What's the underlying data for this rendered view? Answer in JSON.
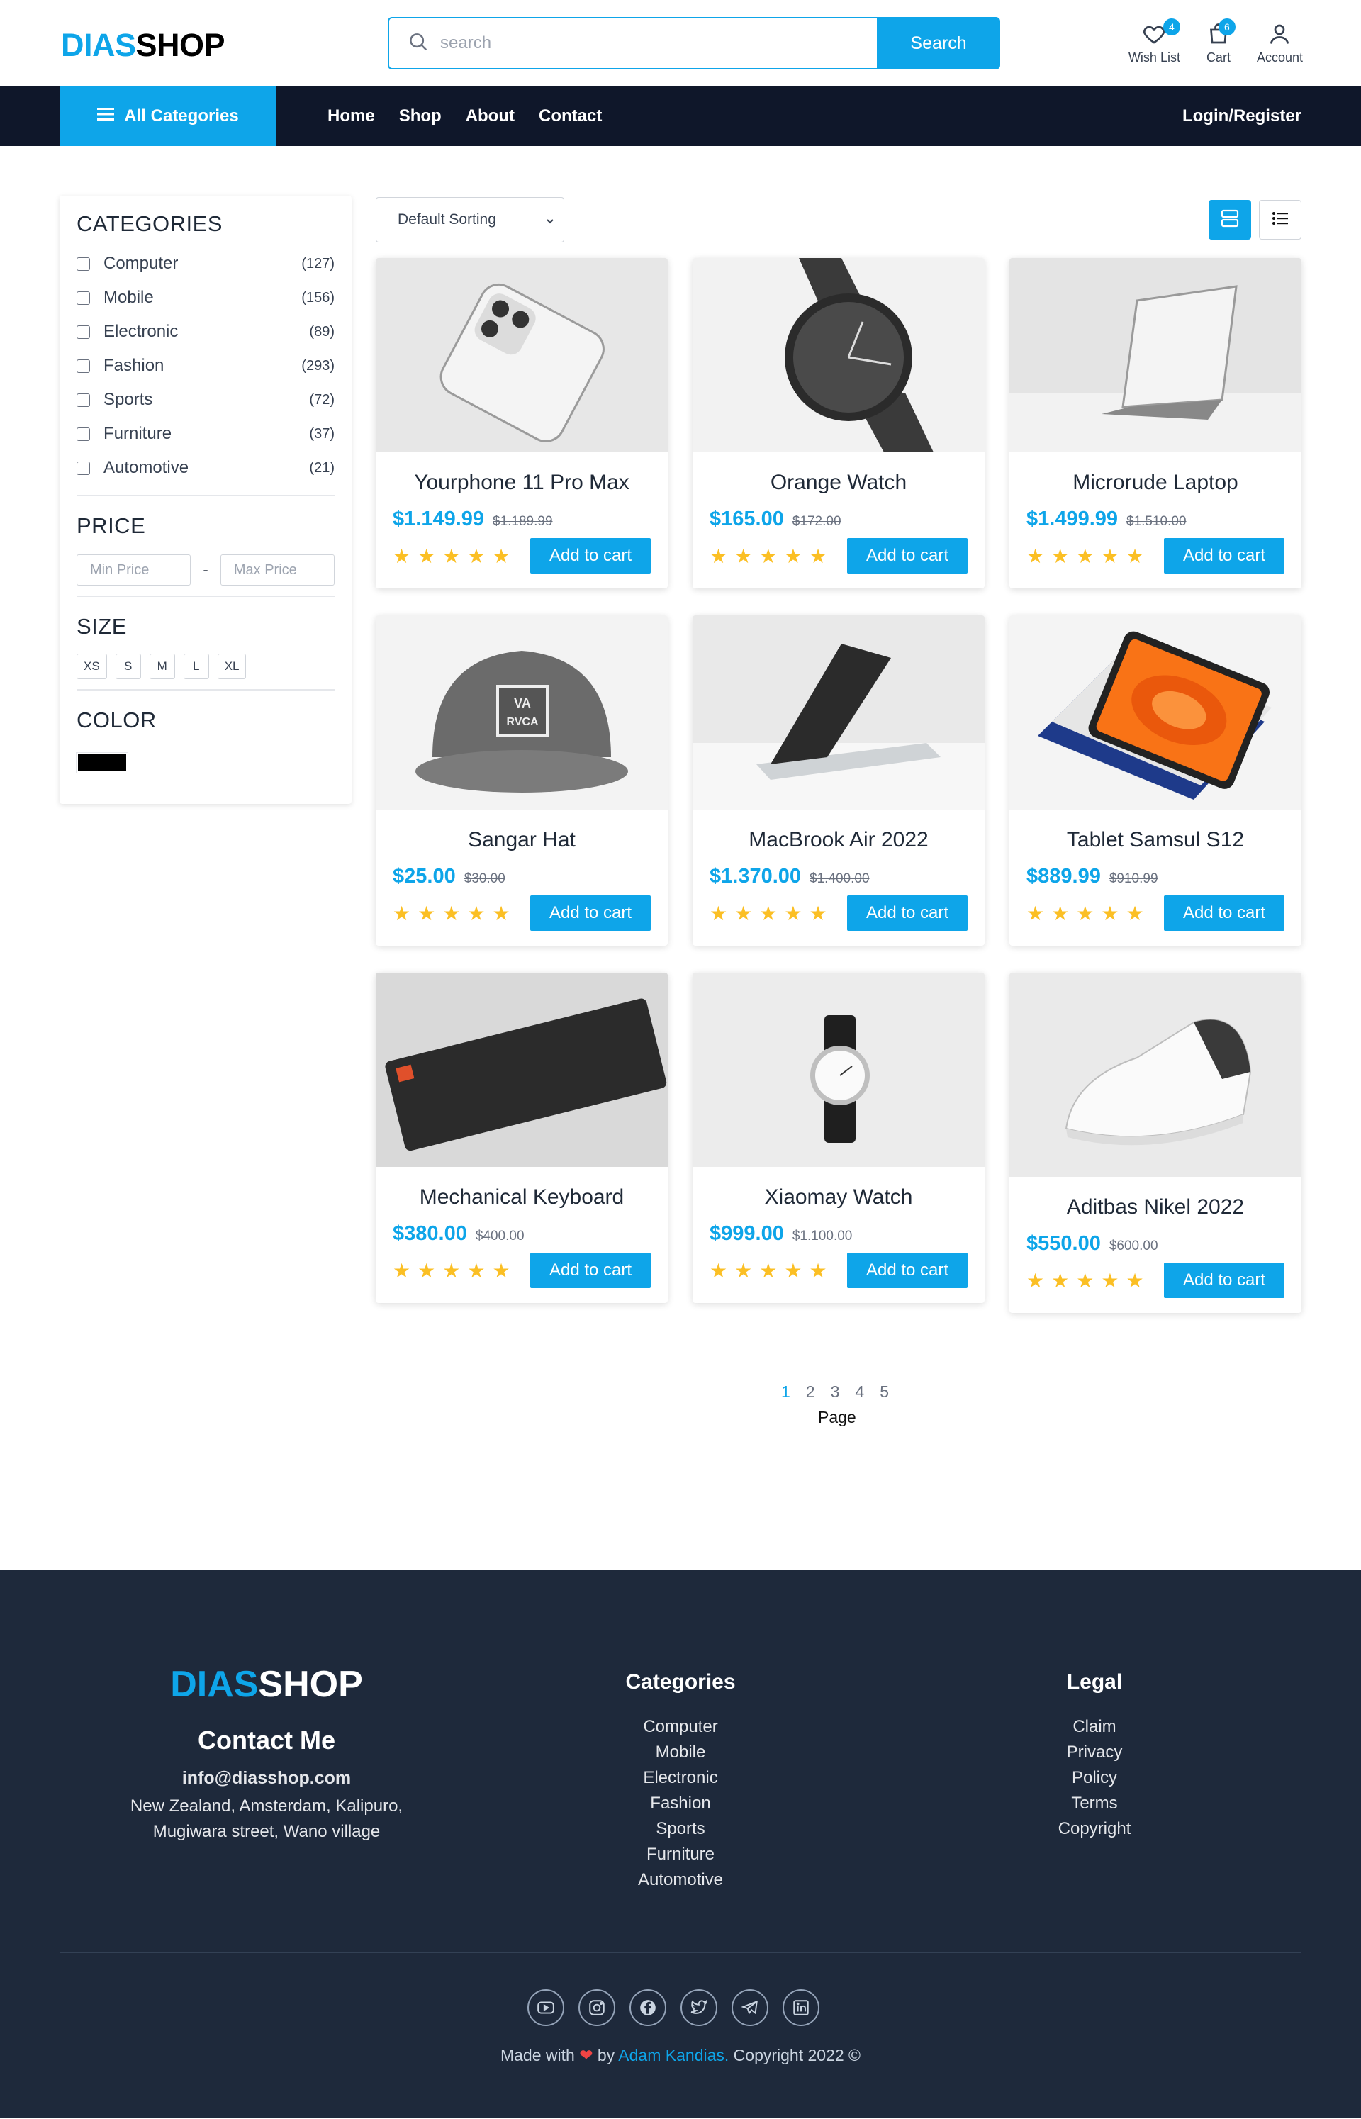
{
  "header": {
    "logo_part1": "DIAS",
    "logo_part2": "SHOP",
    "search_placeholder": "search",
    "search_button": "Search",
    "wishlist_label": "Wish List",
    "wishlist_count": "4",
    "cart_label": "Cart",
    "cart_count": "6",
    "account_label": "Account"
  },
  "nav": {
    "all_categories": "All Categories",
    "links": [
      "Home",
      "Shop",
      "About",
      "Contact"
    ],
    "login": "Login/Register"
  },
  "sidebar": {
    "categories_title": "CATEGORIES",
    "categories": [
      {
        "name": "Computer",
        "count": "(127)"
      },
      {
        "name": "Mobile",
        "count": "(156)"
      },
      {
        "name": "Electronic",
        "count": "(89)"
      },
      {
        "name": "Fashion",
        "count": "(293)"
      },
      {
        "name": "Sports",
        "count": "(72)"
      },
      {
        "name": "Furniture",
        "count": "(37)"
      },
      {
        "name": "Automotive",
        "count": "(21)"
      }
    ],
    "price_title": "PRICE",
    "min_placeholder": "Min Price",
    "max_placeholder": "Max Price",
    "dash": "-",
    "size_title": "SIZE",
    "sizes": [
      "XS",
      "S",
      "M",
      "L",
      "XL"
    ],
    "color_title": "COLOR",
    "color_swatch": "#000000"
  },
  "toolbar": {
    "sort_value": "Default Sorting"
  },
  "products": [
    {
      "name": "Yourphone 11 Pro Max",
      "price": "$1.149.99",
      "old_price": "$1.189.99",
      "rating": 5,
      "button": "Add to cart"
    },
    {
      "name": "Orange Watch",
      "price": "$165.00",
      "old_price": "$172.00",
      "rating": 5,
      "button": "Add to cart"
    },
    {
      "name": "Microrude Laptop",
      "price": "$1.499.99",
      "old_price": "$1.510.00",
      "rating": 5,
      "button": "Add to cart"
    },
    {
      "name": "Sangar Hat",
      "price": "$25.00",
      "old_price": "$30.00",
      "rating": 5,
      "button": "Add to cart"
    },
    {
      "name": "MacBrook Air 2022",
      "price": "$1.370.00",
      "old_price": "$1.400.00",
      "rating": 5,
      "button": "Add to cart"
    },
    {
      "name": "Tablet Samsul S12",
      "price": "$889.99",
      "old_price": "$910.99",
      "rating": 5,
      "button": "Add to cart"
    },
    {
      "name": "Mechanical Keyboard",
      "price": "$380.00",
      "old_price": "$400.00",
      "rating": 5,
      "button": "Add to cart"
    },
    {
      "name": "Xiaomay Watch",
      "price": "$999.00",
      "old_price": "$1.100.00",
      "rating": 5,
      "button": "Add to cart"
    },
    {
      "name": "Aditbas Nikel 2022",
      "price": "$550.00",
      "old_price": "$600.00",
      "rating": 5,
      "button": "Add to cart"
    }
  ],
  "pagination": {
    "pages": [
      "1",
      "2",
      "3",
      "4",
      "5"
    ],
    "current": "1",
    "label": "Page"
  },
  "footer": {
    "logo_part1": "DIAS",
    "logo_part2": "SHOP",
    "contact_title": "Contact Me",
    "email": "info@diasshop.com",
    "address_line1": "New Zealand, Amsterdam, Kalipuro,",
    "address_line2": "Mugiwara street, Wano village",
    "categories_title": "Categories",
    "categories": [
      "Computer",
      "Mobile",
      "Electronic",
      "Fashion",
      "Sports",
      "Furniture",
      "Automotive"
    ],
    "legal_title": "Legal",
    "legal": [
      "Claim",
      "Privacy",
      "Policy",
      "Terms",
      "Copyright"
    ],
    "socials": [
      "youtube-icon",
      "instagram-icon",
      "facebook-icon",
      "twitter-icon",
      "telegram-icon",
      "linkedin-icon"
    ],
    "credit_made": "Made with",
    "credit_heart": "❤",
    "credit_by": "by",
    "credit_name": "Adam Kandias.",
    "credit_copy": "Copyright 2022 ©"
  },
  "colors": {
    "accent": "#0ea5e9",
    "nav_bg": "#0f172a",
    "footer_bg": "#1e293b",
    "star": "#fbbf24"
  }
}
